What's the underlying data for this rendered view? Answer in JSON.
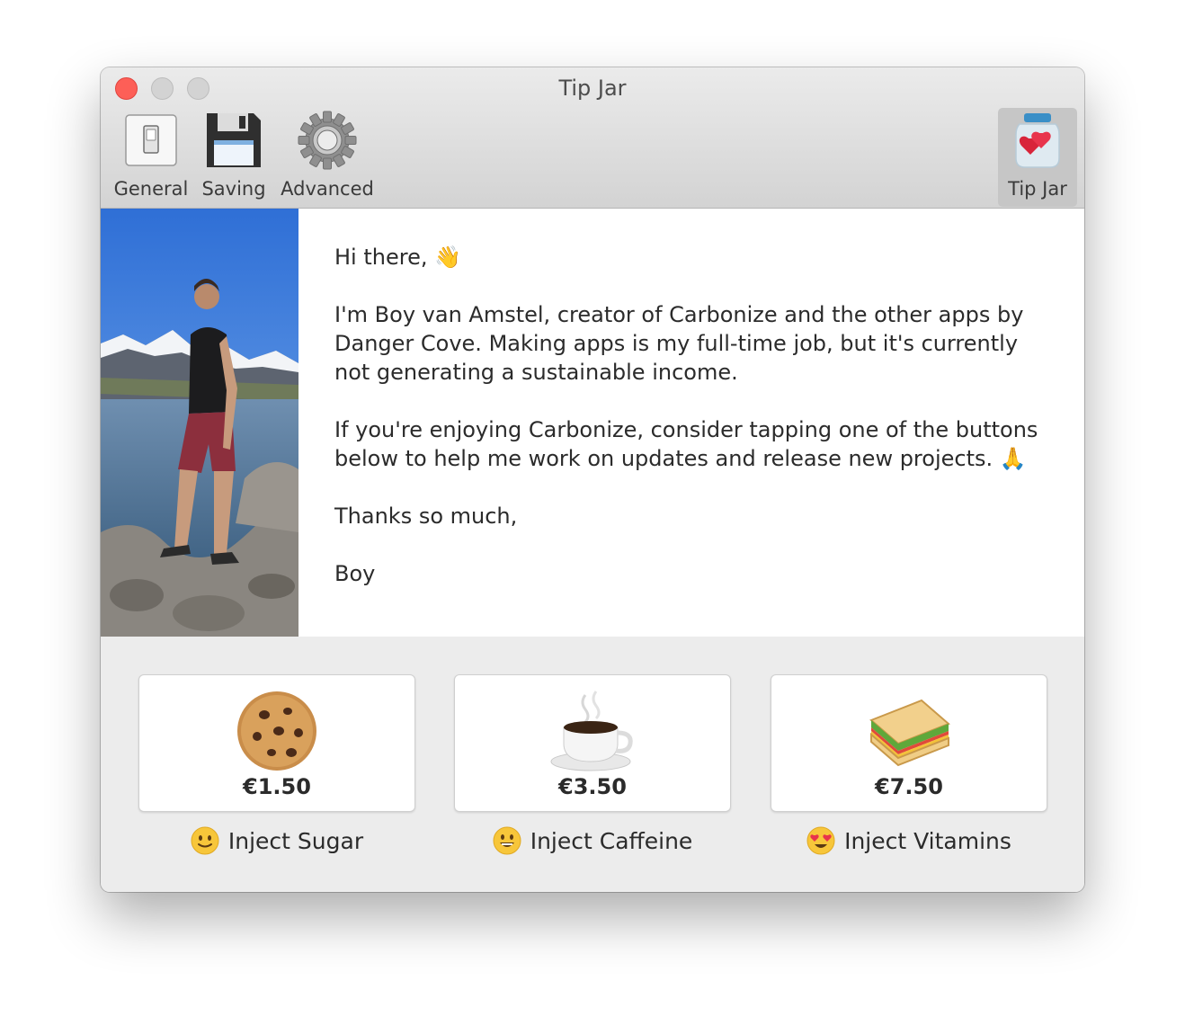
{
  "window": {
    "title": "Tip Jar"
  },
  "toolbar": {
    "items": [
      {
        "label": "General",
        "icon": "light-switch-icon"
      },
      {
        "label": "Saving",
        "icon": "floppy-disk-icon"
      },
      {
        "label": "Advanced",
        "icon": "gear-icon"
      },
      {
        "label": "Tip Jar",
        "icon": "tip-jar-icon",
        "selected": true
      }
    ]
  },
  "message": {
    "greeting": "Hi there, 👋",
    "paragraph1": "I'm Boy van Amstel, creator of Carbonize and the other apps by Danger Cove. Making apps is my full-time job, but it's currently not generating a sustainable income.",
    "paragraph2": "If you're enjoying Carbonize, consider tapping one of the buttons below to help me work on updates and release new projects. 🙏",
    "closing": "Thanks so much,",
    "signature": "Boy"
  },
  "tips": [
    {
      "price": "€1.50",
      "caption": "Inject Sugar",
      "icon": "cookie-icon",
      "mood": "slight-smile-icon"
    },
    {
      "price": "€3.50",
      "caption": "Inject Caffeine",
      "icon": "coffee-cup-icon",
      "mood": "grin-icon"
    },
    {
      "price": "€7.50",
      "caption": "Inject Vitamins",
      "icon": "sandwich-icon",
      "mood": "heart-eyes-icon"
    }
  ],
  "colors": {
    "close": "#fd5f57",
    "toolbar_selected": "#c6c6c6"
  }
}
